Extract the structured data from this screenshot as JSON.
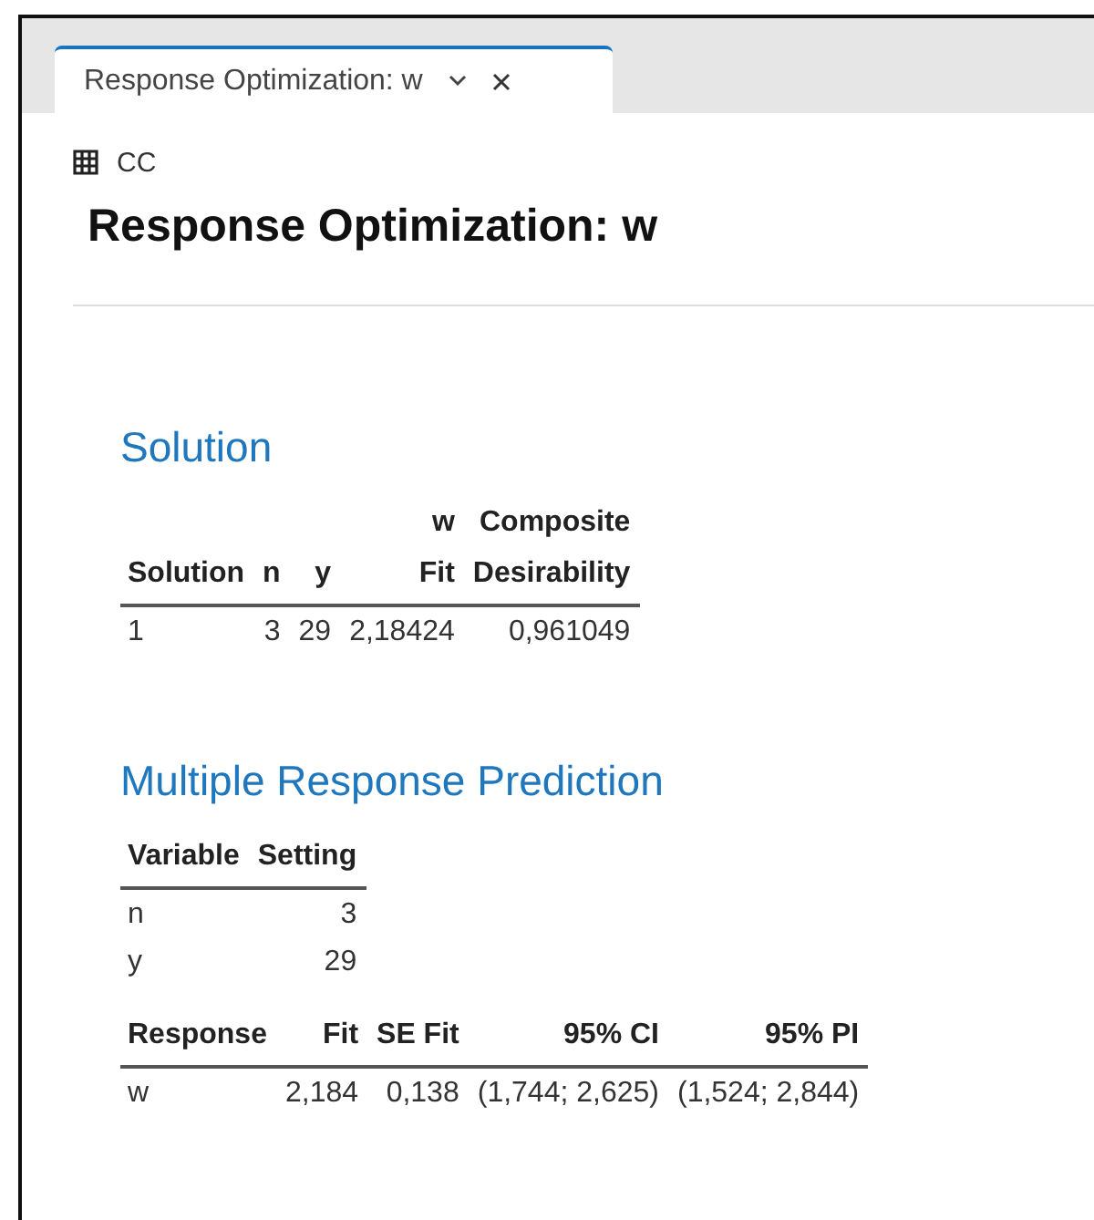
{
  "tab": {
    "label": "Response Optimization: w",
    "selected": true
  },
  "worksheet": "CC",
  "title": "Response Optimization: w",
  "sections": [
    {
      "heading": "Solution",
      "tables": [
        {
          "columns": [
            "Solution",
            "n",
            "y",
            "w\nFit",
            "Composite\nDesirability"
          ],
          "rows": [
            [
              "1",
              "3",
              "29",
              "2,18424",
              "0,961049"
            ]
          ]
        }
      ]
    },
    {
      "heading": "Multiple Response Prediction",
      "tables": [
        {
          "columns": [
            "Variable",
            "Setting"
          ],
          "rows": [
            [
              "n",
              "3"
            ],
            [
              "y",
              "29"
            ]
          ]
        },
        {
          "columns": [
            "Response",
            "Fit",
            "SE Fit",
            "95% CI",
            "95% PI"
          ],
          "rows": [
            [
              "w",
              "2,184",
              "0,138",
              "(1,744; 2,625)",
              "(1,524; 2,844)"
            ]
          ]
        }
      ]
    }
  ]
}
